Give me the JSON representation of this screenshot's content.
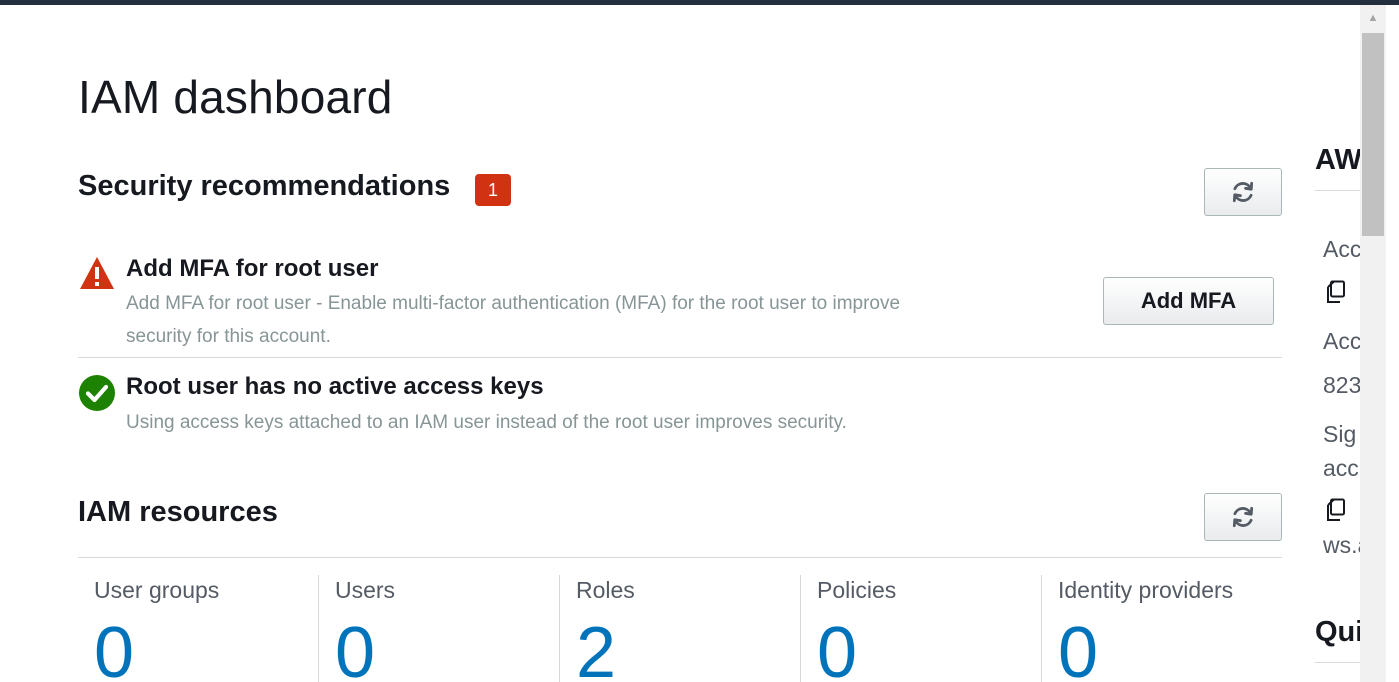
{
  "page": {
    "title": "IAM dashboard"
  },
  "security": {
    "title": "Security recommendations",
    "badge_count": "1",
    "refresh_icon": "refresh-icon",
    "recommendations": [
      {
        "status": "warning",
        "icon": "warning-icon",
        "title": "Add MFA for root user",
        "desc_line1": "Add MFA for root user - Enable multi-factor authentication (MFA) for the root user to improve",
        "desc_line2": "security for this account.",
        "action_label": "Add MFA"
      },
      {
        "status": "success",
        "icon": "check-circle-icon",
        "title": "Root user has no active access keys",
        "desc_line1": "Using access keys attached to an IAM user instead of the root user improves security."
      }
    ]
  },
  "resources": {
    "title": "IAM resources",
    "refresh_icon": "refresh-icon",
    "items": [
      {
        "label": "User groups",
        "value": "0"
      },
      {
        "label": "Users",
        "value": "0"
      },
      {
        "label": "Roles",
        "value": "2"
      },
      {
        "label": "Policies",
        "value": "0"
      },
      {
        "label": "Identity providers",
        "value": "0"
      }
    ]
  },
  "sidebar": {
    "account_title": "AW",
    "account_id_label": "Acc",
    "account_alias_label": "Acc",
    "account_number": "823",
    "signin_label_line1": "Sig",
    "signin_label_line2": "acc",
    "signin_url": "ws.a",
    "quick_title": "Qui",
    "copy_icon": "copy-icon"
  },
  "colors": {
    "accent": "#0073bb",
    "badge": "#d13212",
    "warning": "#d13212",
    "success": "#1d8102",
    "topbar": "#232f3e"
  }
}
